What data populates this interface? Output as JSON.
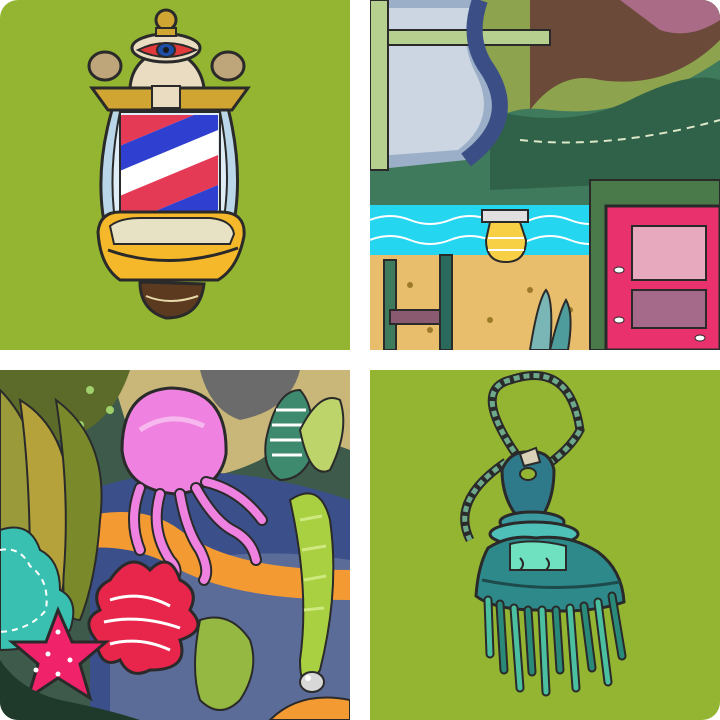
{
  "puzzle": {
    "tiles": [
      {
        "id": 0,
        "subject": "barber-pole",
        "bg": "#94b532"
      },
      {
        "id": 1,
        "subject": "coastal-scene"
      },
      {
        "id": 2,
        "subject": "jellyfish-reef"
      },
      {
        "id": 3,
        "subject": "jellyfish-brush-charm",
        "bg": "#94b532"
      }
    ],
    "colors": {
      "tile_green": "#94b532",
      "divider": "#ffffff"
    }
  }
}
